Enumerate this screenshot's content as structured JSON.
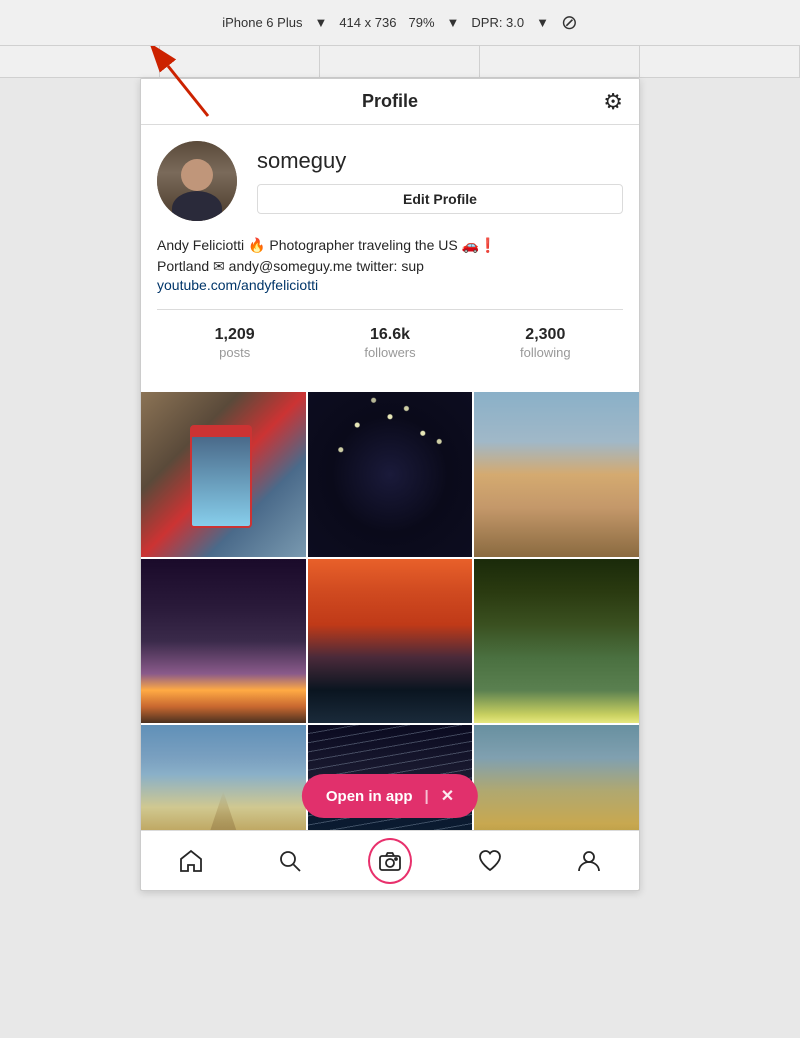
{
  "browser_bar": {
    "device": "iPhone 6 Plus",
    "width": "414",
    "x": "x",
    "height": "736",
    "zoom": "79%",
    "dpr": "DPR: 3.0"
  },
  "app": {
    "header": {
      "title": "Profile",
      "settings_icon": "⚙"
    },
    "profile": {
      "username": "someguy",
      "edit_button": "Edit Profile",
      "bio_line1": "Andy Feliciotti 🔥 Photographer traveling the US 🚗❗",
      "bio_line2": "Portland ✉ andy@someguy.me twitter: sup",
      "bio_link": "youtube.com/andyfeliciotti",
      "stats": {
        "posts_count": "1,209",
        "posts_label": "posts",
        "followers_count": "16.6k",
        "followers_label": "followers",
        "following_count": "2,300",
        "following_label": "following"
      }
    },
    "open_in_app": {
      "label": "Open in app",
      "divider": "|",
      "close": "✕"
    },
    "nav": {
      "home": "🏠",
      "search": "🔍",
      "camera": "📷",
      "heart": "♡",
      "person": "👤"
    }
  }
}
